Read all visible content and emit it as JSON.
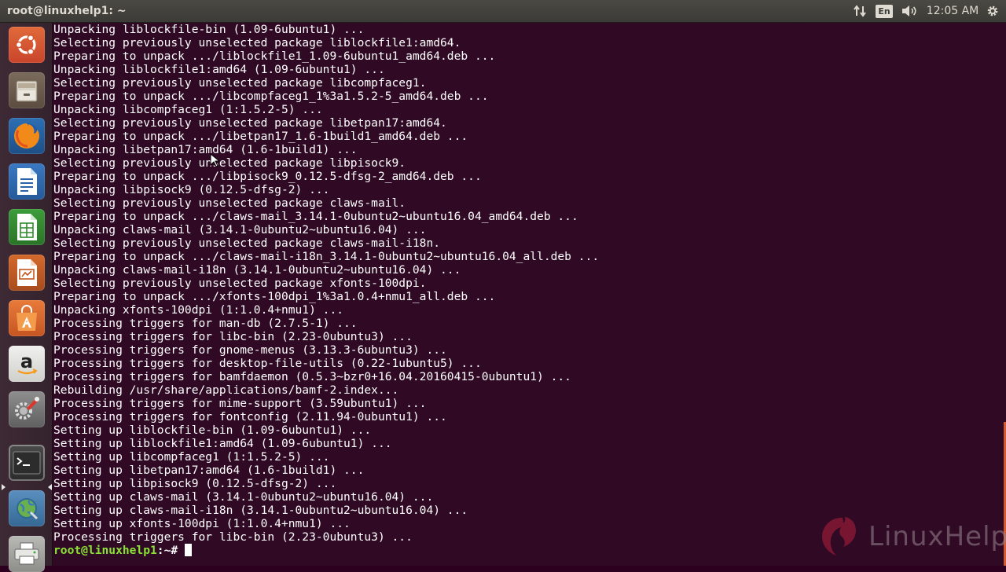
{
  "window": {
    "title": "root@linuxhelp1: ~"
  },
  "panel": {
    "keyboard_layout": "En",
    "clock": "12:05 AM",
    "network_icon": "network-updown-icon",
    "volume_icon": "speaker-volume-icon",
    "settings_icon": "gear-icon"
  },
  "launcher": {
    "items": [
      {
        "name": "Search your computer (Dash)",
        "icon": "ubuntu-dash-icon"
      },
      {
        "name": "Files",
        "icon": "file-cabinet-icon"
      },
      {
        "name": "Firefox Web Browser",
        "icon": "firefox-icon"
      },
      {
        "name": "LibreOffice Writer",
        "icon": "writer-document-icon"
      },
      {
        "name": "LibreOffice Calc",
        "icon": "calc-spreadsheet-icon"
      },
      {
        "name": "LibreOffice Impress",
        "icon": "impress-presentation-icon"
      },
      {
        "name": "Ubuntu Software",
        "icon": "software-bag-icon"
      },
      {
        "name": "Amazon",
        "icon": "amazon-icon"
      },
      {
        "name": "System Settings",
        "icon": "settings-wrench-icon"
      },
      {
        "name": "Terminal",
        "icon": "terminal-icon"
      },
      {
        "name": "Workspace Switcher / Network",
        "icon": "globe-tools-icon"
      },
      {
        "name": "Printer",
        "icon": "printer-icon"
      }
    ]
  },
  "terminal": {
    "lines": [
      "Unpacking liblockfile-bin (1.09-6ubuntu1) ...",
      "Selecting previously unselected package liblockfile1:amd64.",
      "Preparing to unpack .../liblockfile1_1.09-6ubuntu1_amd64.deb ...",
      "Unpacking liblockfile1:amd64 (1.09-6ubuntu1) ...",
      "Selecting previously unselected package libcompfaceg1.",
      "Preparing to unpack .../libcompfaceg1_1%3a1.5.2-5_amd64.deb ...",
      "Unpacking libcompfaceg1 (1:1.5.2-5) ...",
      "Selecting previously unselected package libetpan17:amd64.",
      "Preparing to unpack .../libetpan17_1.6-1build1_amd64.deb ...",
      "Unpacking libetpan17:amd64 (1.6-1build1) ...",
      "Selecting previously unselected package libpisock9.",
      "Preparing to unpack .../libpisock9_0.12.5-dfsg-2_amd64.deb ...",
      "Unpacking libpisock9 (0.12.5-dfsg-2) ...",
      "Selecting previously unselected package claws-mail.",
      "Preparing to unpack .../claws-mail_3.14.1-0ubuntu2~ubuntu16.04_amd64.deb ...",
      "Unpacking claws-mail (3.14.1-0ubuntu2~ubuntu16.04) ...",
      "Selecting previously unselected package claws-mail-i18n.",
      "Preparing to unpack .../claws-mail-i18n_3.14.1-0ubuntu2~ubuntu16.04_all.deb ...",
      "Unpacking claws-mail-i18n (3.14.1-0ubuntu2~ubuntu16.04) ...",
      "Selecting previously unselected package xfonts-100dpi.",
      "Preparing to unpack .../xfonts-100dpi_1%3a1.0.4+nmu1_all.deb ...",
      "Unpacking xfonts-100dpi (1:1.0.4+nmu1) ...",
      "Processing triggers for man-db (2.7.5-1) ...",
      "Processing triggers for libc-bin (2.23-0ubuntu3) ...",
      "Processing triggers for gnome-menus (3.13.3-6ubuntu3) ...",
      "Processing triggers for desktop-file-utils (0.22-1ubuntu5) ...",
      "Processing triggers for bamfdaemon (0.5.3~bzr0+16.04.20160415-0ubuntu1) ...",
      "Rebuilding /usr/share/applications/bamf-2.index...",
      "Processing triggers for mime-support (3.59ubuntu1) ...",
      "Processing triggers for fontconfig (2.11.94-0ubuntu1) ...",
      "Setting up liblockfile-bin (1.09-6ubuntu1) ...",
      "Setting up liblockfile1:amd64 (1.09-6ubuntu1) ...",
      "Setting up libcompfaceg1 (1:1.5.2-5) ...",
      "Setting up libetpan17:amd64 (1.6-1build1) ...",
      "Setting up libpisock9 (0.12.5-dfsg-2) ...",
      "Setting up claws-mail (3.14.1-0ubuntu2~ubuntu16.04) ...",
      "Setting up claws-mail-i18n (3.14.1-0ubuntu2~ubuntu16.04) ...",
      "Setting up xfonts-100dpi (1:1.0.4+nmu1) ...",
      "Processing triggers for libc-bin (2.23-0ubuntu3) ..."
    ],
    "prompt_user": "root@linuxhelp1",
    "prompt_path": ":~#",
    "prompt_input": " ",
    "colors": {
      "background": "#300a24",
      "text": "#ffffff",
      "prompt": "#8ae234"
    }
  },
  "watermark": {
    "text": "LinuxHelp"
  }
}
